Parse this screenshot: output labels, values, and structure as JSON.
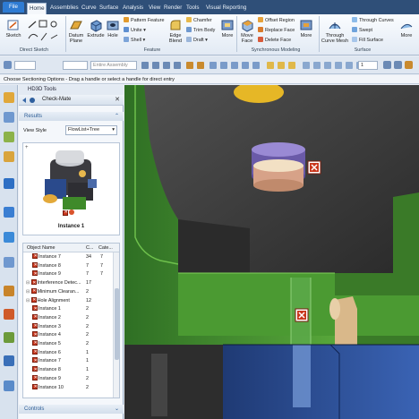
{
  "menu_tabs": [
    "File",
    "Home",
    "Assemblies",
    "Curve",
    "Surface",
    "Analysis",
    "View",
    "Render",
    "Tools",
    "Visual Reporting"
  ],
  "active_tab": "Home",
  "ribbon": {
    "sketch": "Sketch",
    "datum_plane": "Datum Plane",
    "extrude": "Extrude",
    "hole": "Hole",
    "pattern_feature": "Pattern Feature",
    "unite": "Unite",
    "shell": "Shell",
    "edge_blend": "Edge Blend",
    "chamfer": "Chamfer",
    "trim_body": "Trim Body",
    "draft": "Draft",
    "more1": "More",
    "move_face": "Move Face",
    "offset_region": "Offset Region",
    "replace_face": "Replace Face",
    "delete_face": "Delete Face",
    "more2": "More",
    "through_curve_mesh": "Through Curve Mesh",
    "through_curves": "Through Curves",
    "swept": "Swept",
    "fill_surface": "Fill Surface",
    "more3": "More",
    "groups": {
      "direct_sketch": "Direct Sketch",
      "feature": "Feature",
      "synchronous_modeling": "Synchronous Modeling",
      "surface": "Surface"
    }
  },
  "quickbar": {
    "filter_placeholder": "",
    "assembly_scope": "Entire Assembly",
    "number_value": "1"
  },
  "status_text": "Choose Sectioning Options - Drag a handle or select a handle for direct entry",
  "panel": {
    "title": "HD3D Tools",
    "check_mate": "Check-Mate",
    "results_header": "Results",
    "view_style_label": "View Style",
    "view_style_value": "FlowList+Tree",
    "preview_caption": "Instance 1",
    "columns": [
      "Object Name",
      "C...",
      "Cate..."
    ],
    "rows": [
      {
        "name": "Instance 7",
        "c": "34",
        "cate": "7",
        "indent": 1
      },
      {
        "name": "Instance 8",
        "c": "7",
        "cate": "7",
        "indent": 1
      },
      {
        "name": "Instance 9",
        "c": "7",
        "cate": "7",
        "indent": 1
      },
      {
        "name": "Interference Detec...",
        "c": "17",
        "cate": "",
        "indent": 0
      },
      {
        "name": "Minimum Clearan...",
        "c": "2",
        "cate": "",
        "indent": 0
      },
      {
        "name": "Hole Alignment",
        "c": "12",
        "cate": "",
        "indent": 0
      },
      {
        "name": "Instance 1",
        "c": "2",
        "cate": "",
        "indent": 1
      },
      {
        "name": "Instance 2",
        "c": "2",
        "cate": "",
        "indent": 1
      },
      {
        "name": "Instance 3",
        "c": "2",
        "cate": "",
        "indent": 1
      },
      {
        "name": "Instance 4",
        "c": "2",
        "cate": "",
        "indent": 1
      },
      {
        "name": "Instance 5",
        "c": "2",
        "cate": "",
        "indent": 1
      },
      {
        "name": "Instance 6",
        "c": "1",
        "cate": "",
        "indent": 1
      },
      {
        "name": "Instance 7",
        "c": "1",
        "cate": "",
        "indent": 1
      },
      {
        "name": "Instance 8",
        "c": "1",
        "cate": "",
        "indent": 1
      },
      {
        "name": "Instance 9",
        "c": "2",
        "cate": "",
        "indent": 1
      },
      {
        "name": "Instance 10",
        "c": "2",
        "cate": "",
        "indent": 1
      }
    ],
    "controls_header": "Controls"
  },
  "colors": {
    "tabbar": "#2f4f78",
    "model_green": "#3f8a2a",
    "model_dark": "#3a3a3a",
    "model_blue": "#2a4a8c",
    "marker_red": "#c9371d"
  }
}
